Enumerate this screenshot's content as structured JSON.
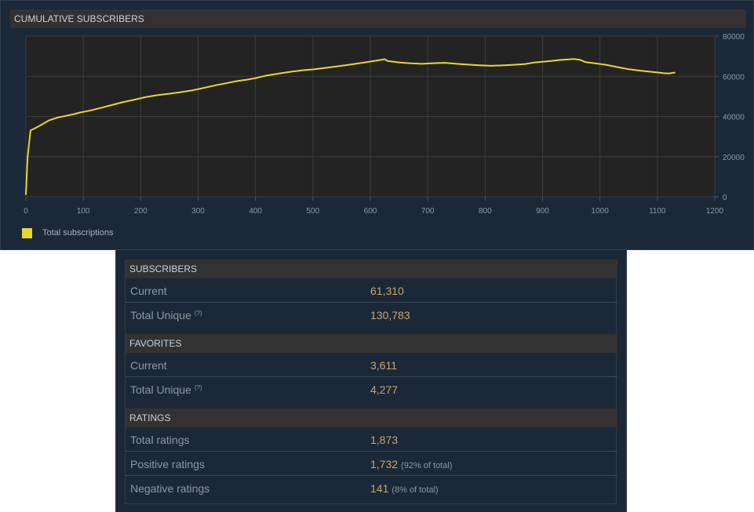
{
  "chart_panel": {
    "header": "CUMULATIVE SUBSCRIBERS"
  },
  "chart_data": {
    "type": "line",
    "title": "CUMULATIVE SUBSCRIBERS",
    "xlim": [
      0,
      1200
    ],
    "ylim": [
      0,
      80000
    ],
    "x_ticks": [
      "0",
      "100",
      "200",
      "300",
      "400",
      "500",
      "600",
      "700",
      "800",
      "900",
      "1000",
      "1100",
      "1200"
    ],
    "y_ticks": [
      "0",
      "20000",
      "40000",
      "60000",
      "80000"
    ],
    "y_axis_side": "right",
    "grid": true,
    "legend_position": "bottom-left",
    "series": [
      {
        "name": "Total subscriptions",
        "color": "#e8d72f",
        "points": [
          [
            0,
            1200
          ],
          [
            3,
            20000
          ],
          [
            8,
            33000
          ],
          [
            15,
            34000
          ],
          [
            25,
            35500
          ],
          [
            40,
            38000
          ],
          [
            55,
            39400
          ],
          [
            70,
            40300
          ],
          [
            85,
            41200
          ],
          [
            95,
            42000
          ],
          [
            110,
            42800
          ],
          [
            130,
            44200
          ],
          [
            150,
            45700
          ],
          [
            170,
            47200
          ],
          [
            190,
            48400
          ],
          [
            210,
            49700
          ],
          [
            230,
            50600
          ],
          [
            250,
            51300
          ],
          [
            270,
            52100
          ],
          [
            290,
            53000
          ],
          [
            310,
            54200
          ],
          [
            330,
            55500
          ],
          [
            350,
            56600
          ],
          [
            365,
            57500
          ],
          [
            375,
            57900
          ],
          [
            385,
            58300
          ],
          [
            400,
            59100
          ],
          [
            420,
            60400
          ],
          [
            440,
            61300
          ],
          [
            460,
            62200
          ],
          [
            480,
            62900
          ],
          [
            500,
            63400
          ],
          [
            520,
            64100
          ],
          [
            540,
            64800
          ],
          [
            560,
            65600
          ],
          [
            580,
            66400
          ],
          [
            600,
            67300
          ],
          [
            615,
            68000
          ],
          [
            625,
            68500
          ],
          [
            630,
            67600
          ],
          [
            650,
            66900
          ],
          [
            670,
            66400
          ],
          [
            690,
            66200
          ],
          [
            710,
            66500
          ],
          [
            730,
            66700
          ],
          [
            750,
            66200
          ],
          [
            770,
            65800
          ],
          [
            790,
            65500
          ],
          [
            810,
            65200
          ],
          [
            830,
            65400
          ],
          [
            850,
            65700
          ],
          [
            870,
            66100
          ],
          [
            885,
            66800
          ],
          [
            900,
            67200
          ],
          [
            915,
            67600
          ],
          [
            930,
            68100
          ],
          [
            945,
            68400
          ],
          [
            955,
            68600
          ],
          [
            965,
            68200
          ],
          [
            975,
            67000
          ],
          [
            990,
            66500
          ],
          [
            1010,
            65700
          ],
          [
            1030,
            64600
          ],
          [
            1050,
            63500
          ],
          [
            1070,
            62800
          ],
          [
            1090,
            62200
          ],
          [
            1110,
            61600
          ],
          [
            1120,
            61400
          ],
          [
            1127,
            61700
          ],
          [
            1130,
            61800
          ]
        ]
      }
    ]
  },
  "legend": {
    "label": "Total subscriptions",
    "color": "#e8d72f"
  },
  "stats": {
    "subscribers": {
      "header": "SUBSCRIBERS",
      "current_label": "Current",
      "current_value": "61,310",
      "unique_label": "Total Unique",
      "unique_help": "(?)",
      "unique_value": "130,783"
    },
    "favorites": {
      "header": "FAVORITES",
      "current_label": "Current",
      "current_value": "3,611",
      "unique_label": "Total Unique",
      "unique_help": "(?)",
      "unique_value": "4,277"
    },
    "ratings": {
      "header": "RATINGS",
      "total_label": "Total ratings",
      "total_value": "1,873",
      "positive_label": "Positive ratings",
      "positive_value": "1,732",
      "positive_note": "(92% of total)",
      "negative_label": "Negative ratings",
      "negative_value": "141",
      "negative_note": "(8% of total)"
    }
  }
}
